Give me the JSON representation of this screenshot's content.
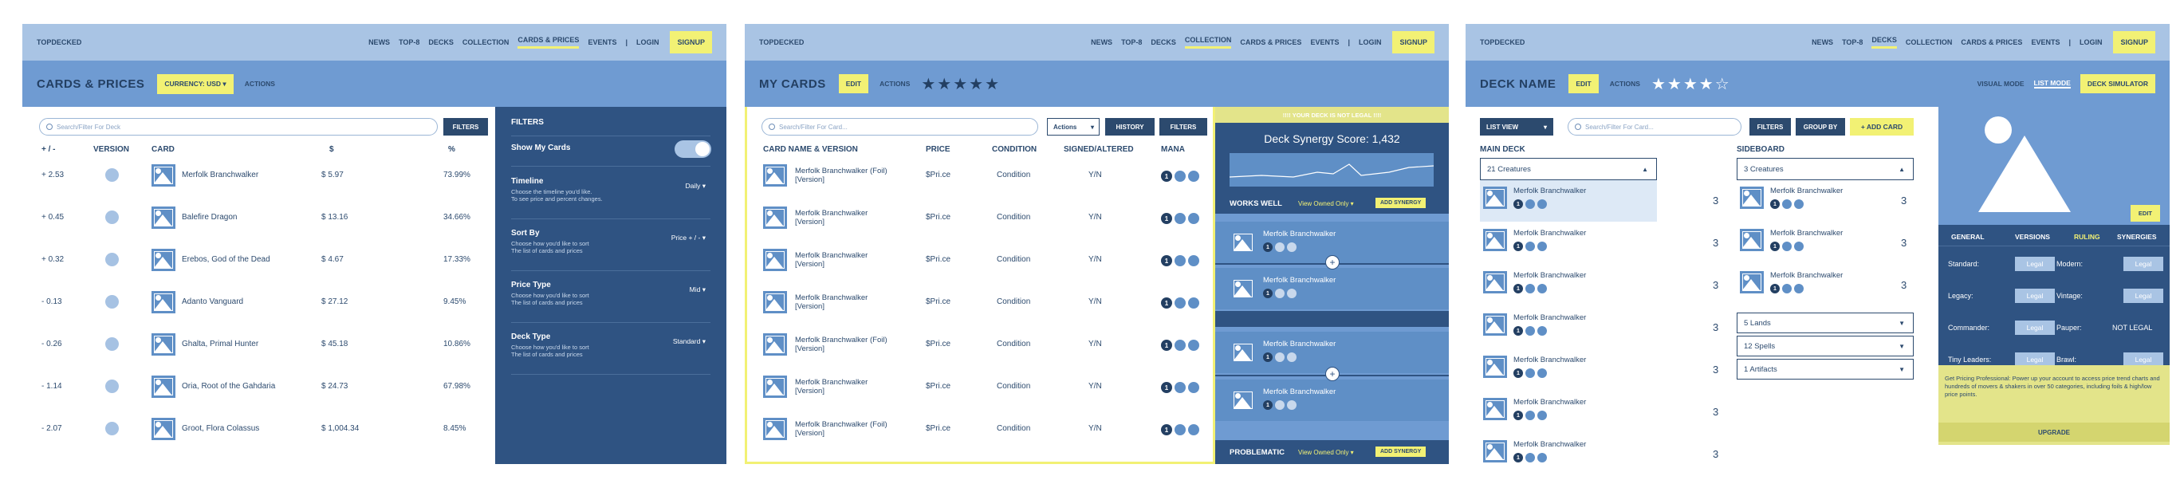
{
  "nav": {
    "logo": "TOPDECKED",
    "links": [
      "NEWS",
      "TOP-8",
      "DECKS",
      "COLLECTION",
      "CARDS & PRICES",
      "EVENTS"
    ],
    "sep": "|",
    "login": "LOGIN",
    "signup": "SIGNUP"
  },
  "p1": {
    "title": "CARDS & PRICES",
    "currency": "CURRENCY: USD",
    "actions": "ACTIONS",
    "search_placeholder": "Search/Filter For Deck",
    "filters_btn": "FILTERS",
    "cols": [
      "+ / -",
      "VERSION",
      "CARD",
      "$",
      "%"
    ],
    "rows": [
      {
        "change": "+ 2.53",
        "name": "Merfolk Branchwalker",
        "price": "$ 5.97",
        "pct": "73.99%"
      },
      {
        "change": "+ 0.45",
        "name": "Balefire Dragon",
        "price": "$ 13.16",
        "pct": "34.66%"
      },
      {
        "change": "+ 0.32",
        "name": "Erebos, God of the Dead",
        "price": "$ 4.67",
        "pct": "17.33%"
      },
      {
        "change": "- 0.13",
        "name": "Adanto Vanguard",
        "price": "$ 27.12",
        "pct": "9.45%"
      },
      {
        "change": "- 0.26",
        "name": "Ghalta, Primal Hunter",
        "price": "$ 45.18",
        "pct": "10.86%"
      },
      {
        "change": "- 1.14",
        "name": "Oria, Root of the Gahdaria",
        "price": "$ 24.73",
        "pct": "67.98%"
      },
      {
        "change": "- 2.07",
        "name": "Groot, Flora Colassus",
        "price": "$ 1,004.34",
        "pct": "8.45%"
      }
    ],
    "filters": {
      "title": "FILTERS",
      "show_my_cards": "Show My Cards",
      "show_my_cards_on": true,
      "items": [
        {
          "label": "Timeline",
          "desc": "Choose the timeline you'd like.\nTo see price and percent changes.",
          "value": "Daily"
        },
        {
          "label": "Sort By",
          "desc": "Choose how you'd like to sort\nThe list of cards and prices",
          "value": "Price + / -"
        },
        {
          "label": "Price Type",
          "desc": "Choose how you'd like to sort\nThe list of cards and prices",
          "value": "Mid"
        },
        {
          "label": "Deck Type",
          "desc": "Choose how you'd like to sort\nThe list of cards and prices",
          "value": "Standard"
        }
      ]
    }
  },
  "p2": {
    "title": "MY CARDS",
    "edit": "EDIT",
    "actions": "ACTIONS",
    "stars": "★★★★★",
    "search_placeholder": "Search/Filter For Card...",
    "actions_select": "Actions",
    "history_btn": "HISTORY",
    "filters_btn": "FILTERS",
    "cols": [
      "CARD NAME & VERSION",
      "PRICE",
      "CONDITION",
      "SIGNED/ALTERED",
      "MANA"
    ],
    "rows": [
      {
        "name": "Merfolk Branchwalker (Foil)\n[Version]",
        "price": "$Pri.ce",
        "condition": "Condition",
        "signed": "Y/N"
      },
      {
        "name": "Merfolk Branchwalker\n[Version]",
        "price": "$Pri.ce",
        "condition": "Condition",
        "signed": "Y/N"
      },
      {
        "name": "Merfolk Branchwalker\n[Version]",
        "price": "$Pri.ce",
        "condition": "Condition",
        "signed": "Y/N"
      },
      {
        "name": "Merfolk Branchwalker\n[Version]",
        "price": "$Pri.ce",
        "condition": "Condition",
        "signed": "Y/N"
      },
      {
        "name": "Merfolk Branchwalker (Foil)\n[Version]",
        "price": "$Pri.ce",
        "condition": "Condition",
        "signed": "Y/N"
      },
      {
        "name": "Merfolk Branchwalker\n[Version]",
        "price": "$Pri.ce",
        "condition": "Condition",
        "signed": "Y/N"
      },
      {
        "name": "Merfolk Branchwalker (Foil)\n[Version]",
        "price": "$Pri.ce",
        "condition": "Condition",
        "signed": "Y/N"
      }
    ],
    "mana_num": "1",
    "warning": "!!!! YOUR DECK IS NOT LEGAL !!!!",
    "synergy": "Deck Synergy Score: 1,432",
    "works_well": "WORKS WELL",
    "view_owned": "View Owned Only",
    "add_synergy": "ADD SYNERGY",
    "problematic": "PROBLEMATIC",
    "syn_card": "Merfolk Branchwalker",
    "plus": "+"
  },
  "p3": {
    "title": "DECK NAME",
    "edit": "EDIT",
    "actions": "ACTIONS",
    "stars": "★★★★☆",
    "visual_mode": "VISUAL MODE",
    "list_mode": "LIST MODE",
    "deck_sim": "DECK SIMULATOR",
    "list_view": "LIST VIEW",
    "search_placeholder": "Search/Filter For Card...",
    "filters_btn": "FILTERS",
    "group_by": "GROUP BY",
    "add_card": "+ ADD CARD",
    "main_deck": "MAIN DECK",
    "sideboard": "SIDEBOARD",
    "main_group": "21 Creatures",
    "side_group": "3 Creatures",
    "card": "Merfolk Branchwalker",
    "qty": "3",
    "mana_num": "1",
    "side_groups": [
      "5 Lands",
      "12 Spells",
      "1 Artifacts"
    ],
    "img_edit": "EDIT",
    "tabs": [
      "GENERAL",
      "VERSIONS",
      "RULING",
      "SYNERGIES"
    ],
    "legality": [
      {
        "fmt": "Standard:",
        "val": "Legal"
      },
      {
        "fmt": "Modern:",
        "val": "Legal"
      },
      {
        "fmt": "Legacy:",
        "val": "Legal"
      },
      {
        "fmt": "Vintage:",
        "val": "Legal"
      },
      {
        "fmt": "Commander:",
        "val": "Legal"
      },
      {
        "fmt": "Pauper:",
        "val": "NOT LEGAL"
      },
      {
        "fmt": "Tiny Leaders:",
        "val": "Legal"
      },
      {
        "fmt": "Brawl:",
        "val": "Legal"
      }
    ],
    "promo": "Get Pricing Professional: Power up your account to access price trend charts and hundreds of movers & shakers in over 50 categories, including foils & high/low price points.",
    "upgrade": "UPGRADE"
  },
  "colors": {
    "nav": "#a9c4e4",
    "header": "#6f9bd2",
    "dark": "#2c4a6e",
    "side": "#2f5382",
    "accent": "#f2f174"
  }
}
